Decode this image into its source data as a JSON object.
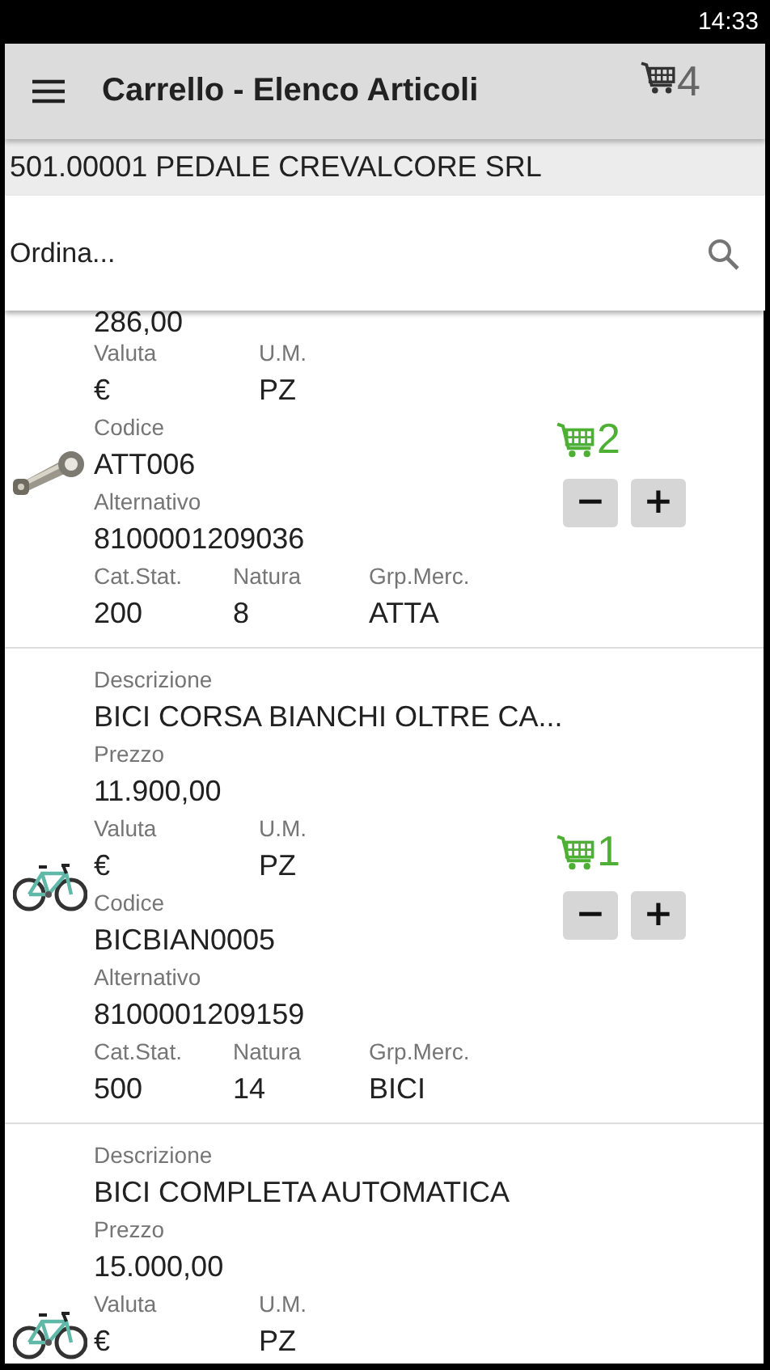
{
  "status_bar": {
    "time": "14:33"
  },
  "app_bar": {
    "title": "Carrello - Elenco Articoli",
    "cart_count": "4"
  },
  "customer": "501.00001 PEDALE CREVALCORE SRL",
  "search": {
    "placeholder": "Ordina..."
  },
  "items": [
    {
      "cart_count": "2",
      "color": "#4db034",
      "minus": "−",
      "plus": "+",
      "rows": [
        [
          {
            "value": "286,00"
          }
        ],
        [
          {
            "label": "Valuta",
            "value": "€"
          },
          {
            "label": "U.M.",
            "value": "PZ"
          }
        ],
        [
          {
            "label": "Codice",
            "value": "ATT006"
          }
        ],
        [
          {
            "label": "Alternativo",
            "value": "8100001209036"
          }
        ],
        [
          {
            "label": "Cat.Stat.",
            "value": "200"
          },
          {
            "label": "Natura",
            "value": "8"
          },
          {
            "label": "Grp.Merc.",
            "value": "ATTA"
          }
        ]
      ]
    },
    {
      "cart_count": "1",
      "color": "#4db034",
      "minus": "−",
      "plus": "+",
      "rows": [
        [
          {
            "label": "Descrizione",
            "value": "BICI CORSA BIANCHI OLTRE CA..."
          }
        ],
        [
          {
            "label": "Prezzo",
            "value": "11.900,00"
          }
        ],
        [
          {
            "label": "Valuta",
            "value": "€"
          },
          {
            "label": "U.M.",
            "value": "PZ"
          }
        ],
        [
          {
            "label": "Codice",
            "value": "BICBIAN0005"
          }
        ],
        [
          {
            "label": "Alternativo",
            "value": "8100001209159"
          }
        ],
        [
          {
            "label": "Cat.Stat.",
            "value": "500"
          },
          {
            "label": "Natura",
            "value": "14"
          },
          {
            "label": "Grp.Merc.",
            "value": "BICI"
          }
        ]
      ]
    },
    {
      "rows": [
        [
          {
            "label": "Descrizione",
            "value": "BICI COMPLETA AUTOMATICA"
          }
        ],
        [
          {
            "label": "Prezzo",
            "value": "15.000,00"
          }
        ],
        [
          {
            "label": "Valuta",
            "value": "€"
          },
          {
            "label": "U.M.",
            "value": "PZ"
          }
        ]
      ]
    }
  ]
}
